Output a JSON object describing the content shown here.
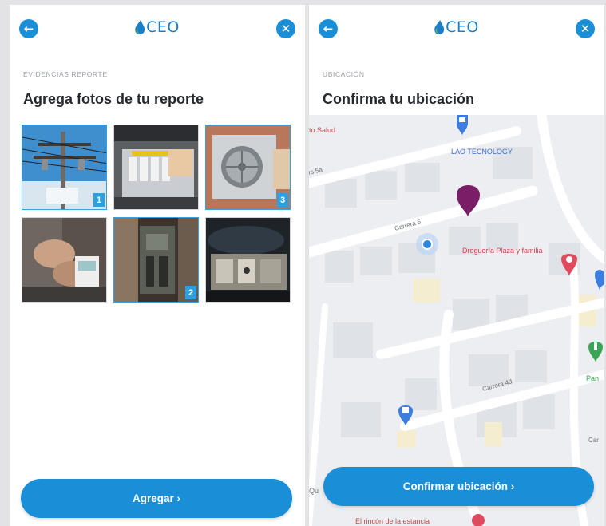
{
  "left_screen": {
    "logo_text": "CEO",
    "section_tag": "EVIDENCIAS REPORTE",
    "title": "Agrega fotos de tu reporte",
    "photos": [
      {
        "description": "power lines",
        "number": "1"
      },
      {
        "description": "electrical panel",
        "number": ""
      },
      {
        "description": "ac unit",
        "number": "3"
      },
      {
        "description": "hands with meter",
        "number": ""
      },
      {
        "description": "electrical box",
        "number": "2"
      },
      {
        "description": "electrical equipment",
        "number": ""
      }
    ],
    "add_button": "Agregar ›"
  },
  "right_screen": {
    "logo_text": "CEO",
    "section_tag": "UBICACIÓN",
    "title": "Confirma tu ubicación",
    "map_labels": {
      "salud": "to Salud",
      "lao": "LAO TECNOLOGY",
      "street_5a": "rs 5a",
      "carrera_5": "Carrera 5",
      "drogueria": "Droguería Plaza y familia",
      "carrera_4d": "Carrera 4d",
      "pan": "Pan",
      "car": "Car",
      "qu": "Qu",
      "rincon": "El rincón de la estancia"
    },
    "confirm_button": "Confirmar ubicación ›"
  },
  "colors": {
    "primary": "#1a8fd8",
    "pin": "#7a1e68",
    "map_bg": "#eceef1",
    "road": "#ffffff",
    "poi_red": "#e04a5e",
    "poi_blue": "#3b7ee0",
    "poi_green": "#3aa655"
  }
}
